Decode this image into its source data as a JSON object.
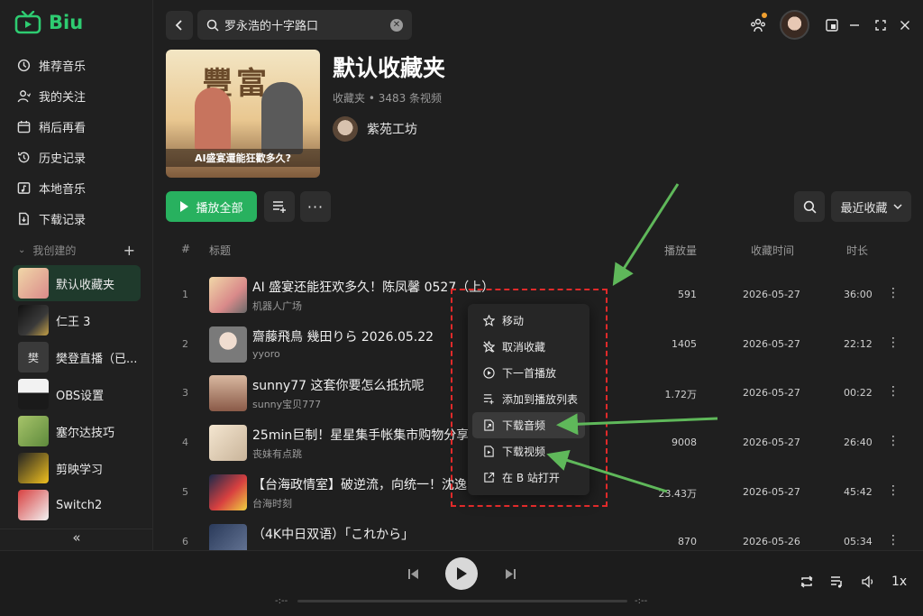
{
  "app": {
    "name": "Biu"
  },
  "colors": {
    "accent": "#28b15f",
    "annotation": "#e02a2a",
    "arrow": "#5fb85a"
  },
  "sidebar": {
    "nav": [
      {
        "label": "推荐音乐",
        "icon": "recommend-icon"
      },
      {
        "label": "我的关注",
        "icon": "user-follow-icon"
      },
      {
        "label": "稍后再看",
        "icon": "calendar-icon"
      },
      {
        "label": "历史记录",
        "icon": "history-icon"
      },
      {
        "label": "本地音乐",
        "icon": "folder-music-icon"
      },
      {
        "label": "下载记录",
        "icon": "download-record-icon"
      }
    ],
    "created_label": "我创建的",
    "playlists": [
      {
        "label": "默认收藏夹"
      },
      {
        "label": "仁王 3"
      },
      {
        "label": "樊登直播（已...",
        "thumb_text": "樊"
      },
      {
        "label": "OBS设置"
      },
      {
        "label": "塞尔达技巧"
      },
      {
        "label": "剪映学习"
      },
      {
        "label": "Switch2"
      }
    ],
    "collapse_glyph": "«"
  },
  "search": {
    "value": "罗永浩的十字路口"
  },
  "header": {
    "title": "默认收藏夹",
    "subtitle": "收藏夹 • 3483 条视频",
    "owner": "紫苑工坊",
    "cover_caption": "AI盛宴還能狂歡多久?"
  },
  "actions": {
    "play_all": "播放全部",
    "sort": "最近收藏"
  },
  "table": {
    "headers": {
      "num": "#",
      "title": "标题",
      "plays": "播放量",
      "fav_time": "收藏时间",
      "duration": "时长"
    },
    "rows": [
      {
        "num": "1",
        "title": "AI 盛宴还能狂欢多久！陈凤馨 0527（上）",
        "uploader": "机器人广场",
        "plays": "591",
        "date": "2026-05-27",
        "duration": "36:00"
      },
      {
        "num": "2",
        "title": "齋藤飛鳥 幾田りら 2026.05.22",
        "uploader": "yyoro",
        "plays": "1405",
        "date": "2026-05-27",
        "duration": "22:12"
      },
      {
        "num": "3",
        "title": "sunny77 这套你要怎么抵抗呢",
        "uploader": "sunny宝贝777",
        "plays": "1.72万",
        "date": "2026-05-27",
        "duration": "00:22"
      },
      {
        "num": "4",
        "title": "25min巨制！星星集手帐集市购物分享",
        "uploader": "丧妹有点跳",
        "plays": "9008",
        "date": "2026-05-27",
        "duration": "26:40"
      },
      {
        "num": "5",
        "title": "【台海政情室】破逆流，向统一！沈逸",
        "uploader": "台海时刻",
        "plays": "23.43万",
        "date": "2026-05-27",
        "duration": "45:42"
      },
      {
        "num": "6",
        "title": "（4K中日双语）「これから」",
        "uploader": "",
        "plays": "870",
        "date": "2026-05-26",
        "duration": "05:34"
      }
    ]
  },
  "context_menu": {
    "items": [
      {
        "label": "移动",
        "icon": "star-icon"
      },
      {
        "label": "取消收藏",
        "icon": "star-off-icon"
      },
      {
        "label": "下一首播放",
        "icon": "play-next-icon"
      },
      {
        "label": "添加到播放列表",
        "icon": "add-to-playlist-icon"
      },
      {
        "label": "下载音频",
        "icon": "download-audio-icon",
        "highlighted": true
      },
      {
        "label": "下载视频",
        "icon": "download-video-icon"
      },
      {
        "label": "在 B 站打开",
        "icon": "external-link-icon"
      }
    ]
  },
  "player": {
    "time_current": "-:--",
    "time_total": "-:--",
    "rate": "1x",
    "progress": 0
  }
}
